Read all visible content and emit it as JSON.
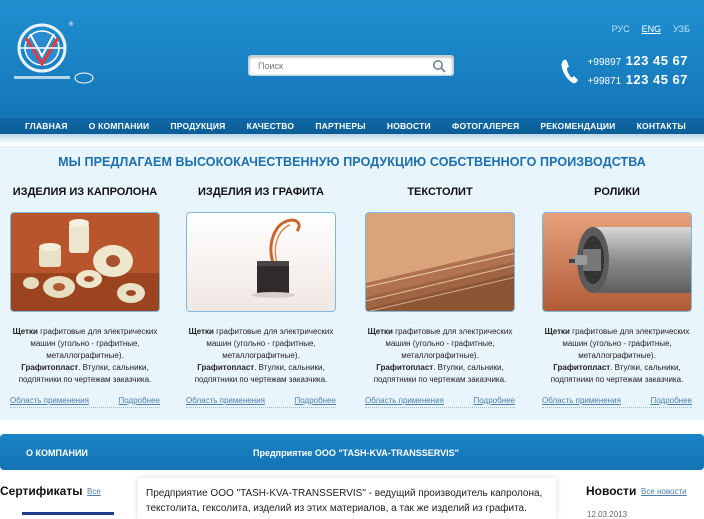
{
  "header": {
    "search_placeholder": "Поиск",
    "languages": [
      "РУС",
      "ENG",
      "УЗБ"
    ],
    "active_language": "ENG",
    "phones": [
      {
        "prefix": "+99897",
        "number": "123 45 67"
      },
      {
        "prefix": "+99871",
        "number": "123 45 67"
      }
    ]
  },
  "nav": [
    "ГЛАВНАЯ",
    "О КОМПАНИИ",
    "ПРОДУКЦИЯ",
    "КАЧЕСТВО",
    "ПАРТНЕРЫ",
    "НОВОСТИ",
    "ФОТОГАЛЕРЕЯ",
    "РЕКОМЕНДАЦИИ",
    "КОНТАКТЫ"
  ],
  "offers": {
    "headline": "МЫ ПРЕДЛАГАЕМ ВЫСОКОКАЧЕСТВЕННУЮ ПРОДУКЦИЮ СОБСТВЕННОГО ПРОИЗВОДСТВА",
    "cards": [
      {
        "title": "ИЗДЕЛИЯ ИЗ КАПРОЛОНА",
        "desc_bold_1": "Щетки",
        "desc_1": " графитовые для электрических машин (угольно - графитные, металлографитные).",
        "desc_bold_2": "Графитопласт",
        "desc_2": ". Втулки, сальники, подпятники по чертежам заказчика.",
        "link_left": "Область применения",
        "link_right": "Подробнее"
      },
      {
        "title": "ИЗДЕЛИЯ ИЗ ГРАФИТА",
        "desc_bold_1": "Щетки",
        "desc_1": " графитовые для электрических машин (угольно - графитные, металлографитные).",
        "desc_bold_2": "Графитопласт",
        "desc_2": ". Втулки, сальники, подпятники по чертежам заказчика.",
        "link_left": "Область применения",
        "link_right": "Подробнее"
      },
      {
        "title": "ТЕКСТОЛИТ",
        "desc_bold_1": "Щетки",
        "desc_1": " графитовые для электрических машин (угольно - графитные, металлографитные).",
        "desc_bold_2": "Графитопласт",
        "desc_2": ". Втулки, сальники, подпятники по чертежам заказчика.",
        "link_left": "Область применения",
        "link_right": "Подробнее"
      },
      {
        "title": "РОЛИКИ",
        "desc_bold_1": "Щетки",
        "desc_1": " графитовые для электрических машин (угольно - графитные, металлографитные).",
        "desc_bold_2": "Графитопласт",
        "desc_2": ". Втулки, сальники, подпятники по чертежам заказчика.",
        "link_left": "Область применения",
        "link_right": "Подробнее"
      }
    ]
  },
  "about_bar": {
    "left": "О КОМПАНИИ",
    "center": "Предприятие ООО \"TASH-KVA-TRANSSERVIS\""
  },
  "certificates": {
    "title": "Сертификаты",
    "all": "Все"
  },
  "about_text": "Предприятие ООО \"TASH-KVA-TRANSSERVIS\" - ведущий производитель капролона, текстолита, гексолита, изделий из этих материалов, а так же изделий из графита.",
  "news": {
    "title": "Новости",
    "all": "Все новости",
    "date": "12.03.2013"
  },
  "colors": {
    "brand_blue": "#1a84c6",
    "headline_blue": "#1a6fae",
    "link": "#4b7ea8",
    "panel_bg": "#e9f5fc"
  }
}
